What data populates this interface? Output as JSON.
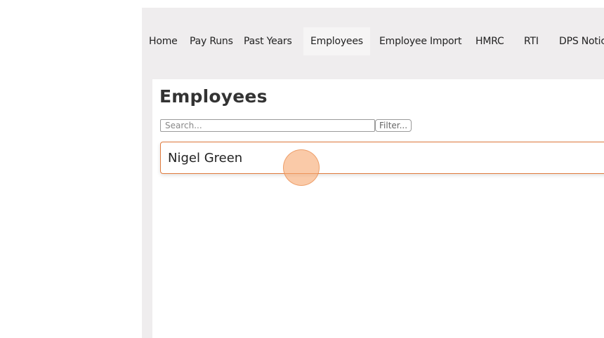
{
  "nav": {
    "items": [
      {
        "label": "Home"
      },
      {
        "label": "Pay Runs"
      },
      {
        "label": "Past Years"
      },
      {
        "label": "Employees",
        "active": true
      },
      {
        "label": "Employee Import"
      },
      {
        "label": "HMRC"
      },
      {
        "label": "RTI"
      },
      {
        "label": "DPS Notices"
      }
    ]
  },
  "page": {
    "title": "Employees"
  },
  "search": {
    "placeholder": "Search...",
    "value": ""
  },
  "filter": {
    "label": "Filter..."
  },
  "employees": [
    {
      "name": "Nigel Green"
    }
  ],
  "colors": {
    "accent": "#e07a3c",
    "nav_background": "#efedee",
    "click_marker": "#f6a66e"
  }
}
